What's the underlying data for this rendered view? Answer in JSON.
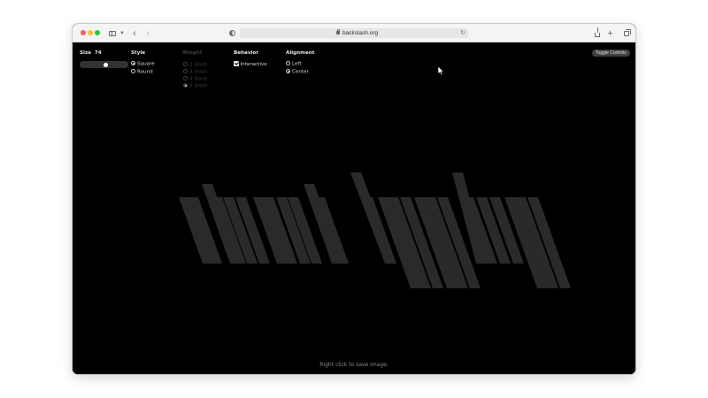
{
  "browser": {
    "url": "backslash.org",
    "icons": {
      "sidebar": "sidebar-icon",
      "back": "chevron-left-icon",
      "forward": "chevron-right-icon",
      "privacy": "shield-icon",
      "lock": "lock-icon",
      "reload": "reload-icon",
      "share": "share-icon",
      "new_tab": "plus-icon",
      "tabs": "tabs-icon"
    }
  },
  "controls": {
    "size": {
      "label": "Size",
      "value": "74",
      "level": 0.42
    },
    "style": {
      "heading": "Style",
      "options": [
        "Square",
        "Round"
      ],
      "selected": "Square"
    },
    "weight": {
      "heading": "Weight",
      "options": [
        "2 Slash",
        "3 Slash",
        "4 Slash",
        "5 Slash"
      ],
      "selected": "5 Slash",
      "disabled": true
    },
    "behavior": {
      "heading": "Behavior",
      "checkbox_label": "Interactive",
      "checked": true
    },
    "alignment": {
      "heading": "Alignment",
      "options": [
        "Left",
        "Center"
      ],
      "selected": "Center"
    },
    "toggle_button": "Toggle Controls"
  },
  "canvas": {
    "text": "start typing",
    "glyph_color": "#2a2a2a",
    "background": "#000000"
  },
  "footer_hint": "Right click to save image."
}
